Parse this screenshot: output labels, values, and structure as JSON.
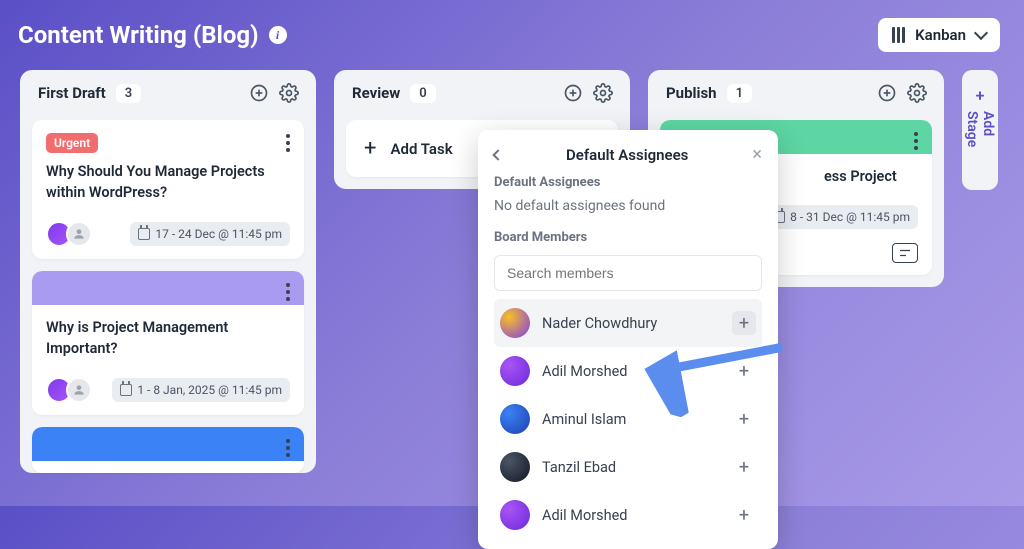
{
  "header": {
    "title": "Content Writing (Blog)",
    "view_label": "Kanban"
  },
  "columns": {
    "draft": {
      "title": "First Draft",
      "count": "3",
      "cards": [
        {
          "tag": "Urgent",
          "title": "Why Should You Manage Projects within WordPress?",
          "due": "17 - 24 Dec @ 11:45 pm"
        },
        {
          "title": "Why is Project Management Important?",
          "due": "1 - 8 Jan, 2025 @ 11:45 pm"
        }
      ]
    },
    "review": {
      "title": "Review",
      "count": "0",
      "add_task_label": "Add Task"
    },
    "publish": {
      "title": "Publish",
      "count": "1",
      "card": {
        "title_suffix": "ess Project",
        "due_suffix": "8 - 31 Dec @ 11:45 pm"
      }
    }
  },
  "add_stage_label": "Add Stage",
  "popover": {
    "title": "Default Assignees",
    "section1": "Default Assignees",
    "empty_msg": "No default assignees found",
    "section2": "Board Members",
    "search_placeholder": "Search members",
    "members": [
      {
        "name": "Nader Chowdhury"
      },
      {
        "name": "Adil Morshed"
      },
      {
        "name": "Aminul Islam"
      },
      {
        "name": "Tanzil Ebad"
      },
      {
        "name": "Adil Morshed"
      }
    ]
  }
}
